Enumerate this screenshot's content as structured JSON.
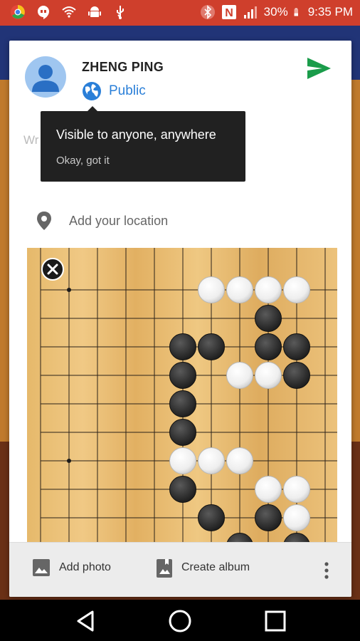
{
  "status_bar": {
    "left_icons": [
      "chrome-icon",
      "hangouts-icon",
      "wifi-icon",
      "android-icon",
      "usb-icon"
    ],
    "right_icons": [
      "bluetooth-icon",
      "nfc-icon",
      "signal-icon",
      "battery-icon"
    ],
    "battery": "30%",
    "time": "9:35 PM"
  },
  "post": {
    "author": "ZHENG PING",
    "audience": "Public",
    "write_placeholder": "Wr",
    "location_label": "Add your location"
  },
  "tooltip": {
    "title": "Visible to anyone, anywhere",
    "action": "Okay, got it"
  },
  "toolbar": {
    "add_photo": "Add photo",
    "create_album": "Create album"
  },
  "board": {
    "white_stones": [
      [
        6,
        1
      ],
      [
        7,
        1
      ],
      [
        8,
        1
      ],
      [
        9,
        1
      ],
      [
        7,
        4
      ],
      [
        8,
        4
      ],
      [
        5,
        7
      ],
      [
        6,
        7
      ],
      [
        7,
        7
      ],
      [
        8,
        8
      ],
      [
        9,
        8
      ],
      [
        9,
        9
      ]
    ],
    "black_stones": [
      [
        8,
        2
      ],
      [
        5,
        3
      ],
      [
        6,
        3
      ],
      [
        8,
        3
      ],
      [
        9,
        3
      ],
      [
        5,
        4
      ],
      [
        9,
        4
      ],
      [
        5,
        5
      ],
      [
        5,
        6
      ],
      [
        5,
        8
      ],
      [
        6,
        9
      ],
      [
        8,
        9
      ],
      [
        7,
        10
      ],
      [
        9,
        10
      ]
    ],
    "star_points": [
      [
        1,
        1
      ],
      [
        1,
        7
      ],
      [
        7,
        7
      ]
    ]
  },
  "colors": {
    "status_bar": "#cf3f2c",
    "accent_blue": "#2a7fd8",
    "send_green": "#1a9c4a",
    "tooltip_bg": "#212121"
  }
}
